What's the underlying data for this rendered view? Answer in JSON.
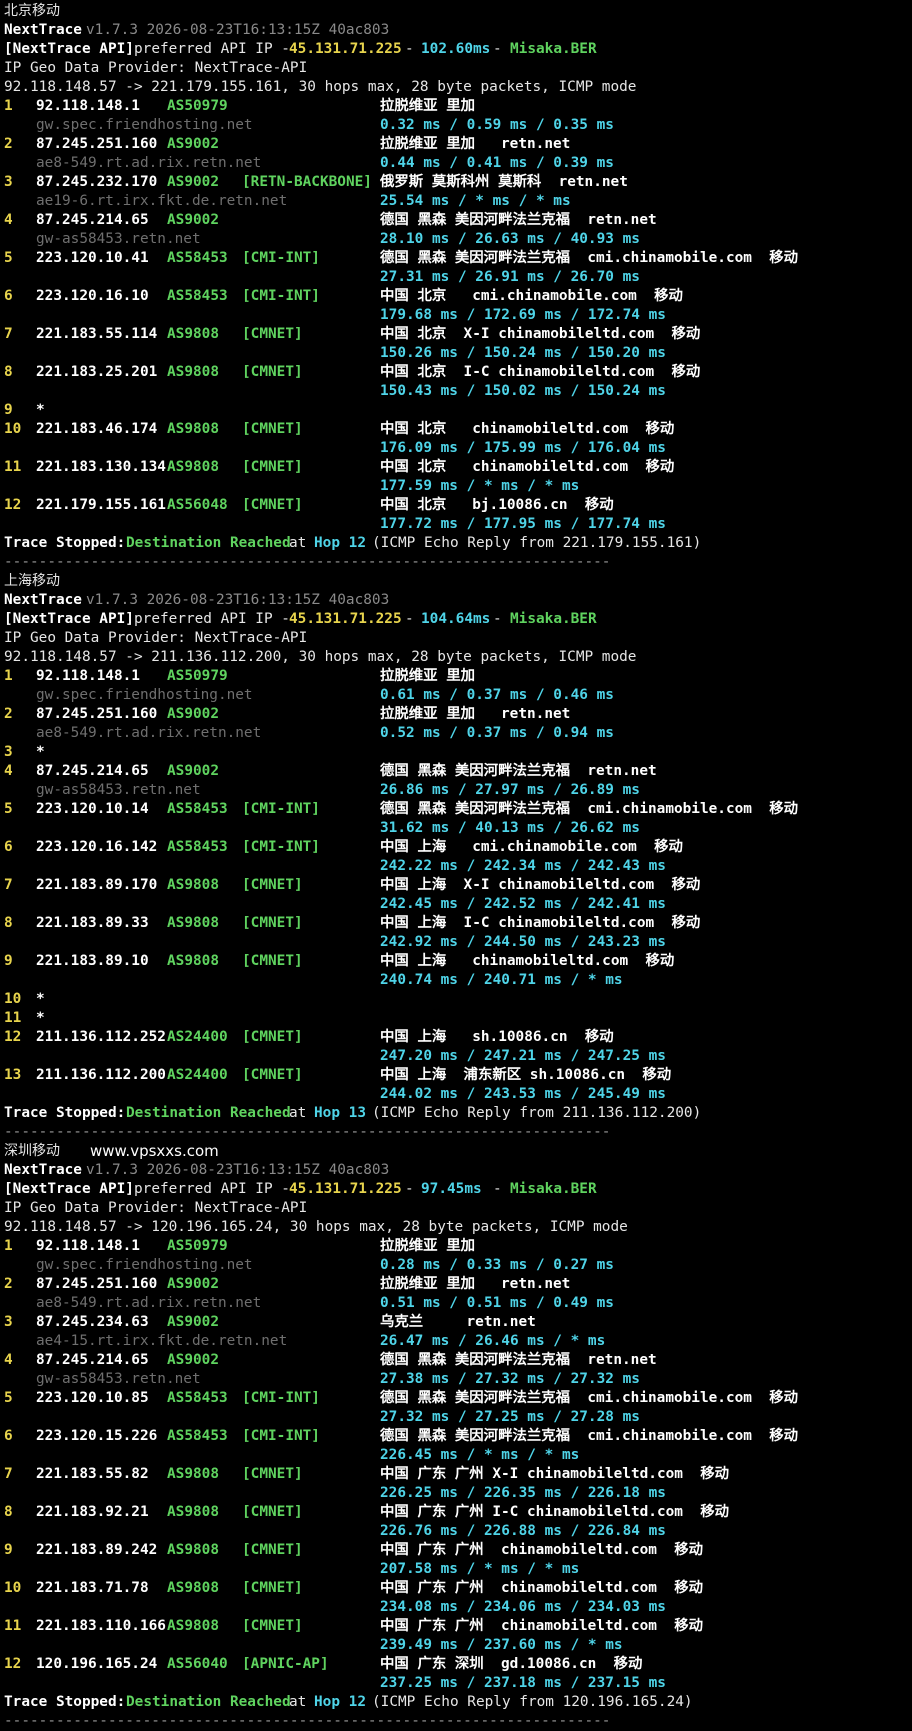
{
  "sections": [
    {
      "title": "北京移动",
      "watermark": "",
      "header": {
        "tool": "NextTrace",
        "version": "v1.7.3 2026-08-23T16:13:15Z 40ac803",
        "api_label": "[NextTrace API]",
        "api_text": "preferred API IP -",
        "api_ip": "45.131.71.225",
        "dash1": "-",
        "api_latency": "102.60ms",
        "dash2": "-",
        "api_node": "Misaka.BER",
        "geo_provider": "IP Geo Data Provider: NextTrace-API",
        "route": "92.118.148.57 -> 221.179.155.161, 30 hops max, 28 byte packets, ICMP mode"
      },
      "hops": [
        {
          "hop": "1",
          "ip": "92.118.148.1",
          "asn": "AS50979",
          "tag": "",
          "geo": "拉脱维亚 里加",
          "host": "gw.spec.friendhosting.net",
          "latency": "0.32 ms / 0.59 ms / 0.35 ms"
        },
        {
          "hop": "2",
          "ip": "87.245.251.160",
          "asn": "AS9002",
          "tag": "",
          "geo": "拉脱维亚 里加   retn.net",
          "host": "ae8-549.rt.ad.rix.retn.net",
          "latency": "0.44 ms / 0.41 ms / 0.39 ms"
        },
        {
          "hop": "3",
          "ip": "87.245.232.170",
          "asn": "AS9002",
          "tag": "[RETN-BACKBONE]",
          "geo": "俄罗斯 莫斯科州 莫斯科  retn.net",
          "host": "ae19-6.rt.irx.fkt.de.retn.net",
          "latency": "25.54 ms / * ms / * ms"
        },
        {
          "hop": "4",
          "ip": "87.245.214.65",
          "asn": "AS9002",
          "tag": "",
          "geo": "德国 黑森 美因河畔法兰克福  retn.net",
          "host": "gw-as58453.retn.net",
          "latency": "28.10 ms / 26.63 ms / 40.93 ms"
        },
        {
          "hop": "5",
          "ip": "223.120.10.41",
          "asn": "AS58453",
          "tag": "[CMI-INT]",
          "geo": "德国 黑森 美因河畔法兰克福  cmi.chinamobile.com  移动",
          "host": "",
          "latency": "27.31 ms / 26.91 ms / 26.70 ms"
        },
        {
          "hop": "6",
          "ip": "223.120.16.10",
          "asn": "AS58453",
          "tag": "[CMI-INT]",
          "geo": "中国 北京   cmi.chinamobile.com  移动",
          "host": "",
          "latency": "179.68 ms / 172.69 ms / 172.74 ms"
        },
        {
          "hop": "7",
          "ip": "221.183.55.114",
          "asn": "AS9808",
          "tag": "[CMNET]",
          "geo": "中国 北京  X-I chinamobileltd.com  移动",
          "host": "",
          "latency": "150.26 ms / 150.24 ms / 150.20 ms"
        },
        {
          "hop": "8",
          "ip": "221.183.25.201",
          "asn": "AS9808",
          "tag": "[CMNET]",
          "geo": "中国 北京  I-C chinamobileltd.com  移动",
          "host": "",
          "latency": "150.43 ms / 150.02 ms / 150.24 ms"
        },
        {
          "hop": "9",
          "ip": "*",
          "asn": "",
          "tag": "",
          "geo": "",
          "host": "",
          "latency": ""
        },
        {
          "hop": "10",
          "ip": "221.183.46.174",
          "asn": "AS9808",
          "tag": "[CMNET]",
          "geo": "中国 北京   chinamobileltd.com  移动",
          "host": "",
          "latency": "176.09 ms / 175.99 ms / 176.04 ms"
        },
        {
          "hop": "11",
          "ip": "221.183.130.134",
          "asn": "AS9808",
          "tag": "[CMNET]",
          "geo": "中国 北京   chinamobileltd.com  移动",
          "host": "",
          "latency": "177.59 ms / * ms / * ms"
        },
        {
          "hop": "12",
          "ip": "221.179.155.161",
          "asn": "AS56048",
          "tag": "[CMNET]",
          "geo": "中国 北京   bj.10086.cn  移动",
          "host": "",
          "latency": "177.72 ms / 177.95 ms / 177.74 ms"
        }
      ],
      "footer": {
        "stopped": "Trace Stopped:",
        "reached": "Destination Reached",
        "at": "at",
        "hop": "Hop 12",
        "rest": "(ICMP Echo Reply from 221.179.155.161)"
      }
    },
    {
      "title": "上海移动",
      "watermark": "",
      "header": {
        "tool": "NextTrace",
        "version": "v1.7.3 2026-08-23T16:13:15Z 40ac803",
        "api_label": "[NextTrace API]",
        "api_text": "preferred API IP -",
        "api_ip": "45.131.71.225",
        "dash1": "-",
        "api_latency": "104.64ms",
        "dash2": "-",
        "api_node": "Misaka.BER",
        "geo_provider": "IP Geo Data Provider: NextTrace-API",
        "route": "92.118.148.57 -> 211.136.112.200, 30 hops max, 28 byte packets, ICMP mode"
      },
      "hops": [
        {
          "hop": "1",
          "ip": "92.118.148.1",
          "asn": "AS50979",
          "tag": "",
          "geo": "拉脱维亚 里加",
          "host": "gw.spec.friendhosting.net",
          "latency": "0.61 ms / 0.37 ms / 0.46 ms"
        },
        {
          "hop": "2",
          "ip": "87.245.251.160",
          "asn": "AS9002",
          "tag": "",
          "geo": "拉脱维亚 里加   retn.net",
          "host": "ae8-549.rt.ad.rix.retn.net",
          "latency": "0.52 ms / 0.37 ms / 0.94 ms"
        },
        {
          "hop": "3",
          "ip": "*",
          "asn": "",
          "tag": "",
          "geo": "",
          "host": "",
          "latency": ""
        },
        {
          "hop": "4",
          "ip": "87.245.214.65",
          "asn": "AS9002",
          "tag": "",
          "geo": "德国 黑森 美因河畔法兰克福  retn.net",
          "host": "gw-as58453.retn.net",
          "latency": "26.86 ms / 27.97 ms / 26.89 ms"
        },
        {
          "hop": "5",
          "ip": "223.120.10.14",
          "asn": "AS58453",
          "tag": "[CMI-INT]",
          "geo": "德国 黑森 美因河畔法兰克福  cmi.chinamobile.com  移动",
          "host": "",
          "latency": "31.62 ms / 40.13 ms / 26.62 ms"
        },
        {
          "hop": "6",
          "ip": "223.120.16.142",
          "asn": "AS58453",
          "tag": "[CMI-INT]",
          "geo": "中国 上海   cmi.chinamobile.com  移动",
          "host": "",
          "latency": "242.22 ms / 242.34 ms / 242.43 ms"
        },
        {
          "hop": "7",
          "ip": "221.183.89.170",
          "asn": "AS9808",
          "tag": "[CMNET]",
          "geo": "中国 上海  X-I chinamobileltd.com  移动",
          "host": "",
          "latency": "242.45 ms / 242.52 ms / 242.41 ms"
        },
        {
          "hop": "8",
          "ip": "221.183.89.33",
          "asn": "AS9808",
          "tag": "[CMNET]",
          "geo": "中国 上海  I-C chinamobileltd.com  移动",
          "host": "",
          "latency": "242.92 ms / 244.50 ms / 243.23 ms"
        },
        {
          "hop": "9",
          "ip": "221.183.89.10",
          "asn": "AS9808",
          "tag": "[CMNET]",
          "geo": "中国 上海   chinamobileltd.com  移动",
          "host": "",
          "latency": "240.74 ms / 240.71 ms / * ms"
        },
        {
          "hop": "10",
          "ip": "*",
          "asn": "",
          "tag": "",
          "geo": "",
          "host": "",
          "latency": ""
        },
        {
          "hop": "11",
          "ip": "*",
          "asn": "",
          "tag": "",
          "geo": "",
          "host": "",
          "latency": ""
        },
        {
          "hop": "12",
          "ip": "211.136.112.252",
          "asn": "AS24400",
          "tag": "[CMNET]",
          "geo": "中国 上海   sh.10086.cn  移动",
          "host": "",
          "latency": "247.20 ms / 247.21 ms / 247.25 ms"
        },
        {
          "hop": "13",
          "ip": "211.136.112.200",
          "asn": "AS24400",
          "tag": "[CMNET]",
          "geo": "中国 上海  浦东新区 sh.10086.cn  移动",
          "host": "",
          "latency": "244.02 ms / 243.53 ms / 245.49 ms"
        }
      ],
      "footer": {
        "stopped": "Trace Stopped:",
        "reached": "Destination Reached",
        "at": "at",
        "hop": "Hop 13",
        "rest": "(ICMP Echo Reply from 211.136.112.200)"
      }
    },
    {
      "title": "深圳移动",
      "watermark": "www.vpsxxs.com",
      "header": {
        "tool": "NextTrace",
        "version": "v1.7.3 2026-08-23T16:13:15Z 40ac803",
        "api_label": "[NextTrace API]",
        "api_text": "preferred API IP -",
        "api_ip": "45.131.71.225",
        "dash1": "-",
        "api_latency": "97.45ms",
        "dash2": "-",
        "api_node": "Misaka.BER",
        "geo_provider": "IP Geo Data Provider: NextTrace-API",
        "route": "92.118.148.57 -> 120.196.165.24, 30 hops max, 28 byte packets, ICMP mode"
      },
      "hops": [
        {
          "hop": "1",
          "ip": "92.118.148.1",
          "asn": "AS50979",
          "tag": "",
          "geo": "拉脱维亚 里加",
          "host": "gw.spec.friendhosting.net",
          "latency": "0.28 ms / 0.33 ms / 0.27 ms"
        },
        {
          "hop": "2",
          "ip": "87.245.251.160",
          "asn": "AS9002",
          "tag": "",
          "geo": "拉脱维亚 里加   retn.net",
          "host": "ae8-549.rt.ad.rix.retn.net",
          "latency": "0.51 ms / 0.51 ms / 0.49 ms"
        },
        {
          "hop": "3",
          "ip": "87.245.234.63",
          "asn": "AS9002",
          "tag": "",
          "geo": "乌克兰     retn.net",
          "host": "ae4-15.rt.irx.fkt.de.retn.net",
          "latency": "26.47 ms / 26.46 ms / * ms"
        },
        {
          "hop": "4",
          "ip": "87.245.214.65",
          "asn": "AS9002",
          "tag": "",
          "geo": "德国 黑森 美因河畔法兰克福  retn.net",
          "host": "gw-as58453.retn.net",
          "latency": "27.38 ms / 27.32 ms / 27.32 ms"
        },
        {
          "hop": "5",
          "ip": "223.120.10.85",
          "asn": "AS58453",
          "tag": "[CMI-INT]",
          "geo": "德国 黑森 美因河畔法兰克福  cmi.chinamobile.com  移动",
          "host": "",
          "latency": "27.32 ms / 27.25 ms / 27.28 ms"
        },
        {
          "hop": "6",
          "ip": "223.120.15.226",
          "asn": "AS58453",
          "tag": "[CMI-INT]",
          "geo": "德国 黑森 美因河畔法兰克福  cmi.chinamobile.com  移动",
          "host": "",
          "latency": "226.45 ms / * ms / * ms"
        },
        {
          "hop": "7",
          "ip": "221.183.55.82",
          "asn": "AS9808",
          "tag": "[CMNET]",
          "geo": "中国 广东 广州 X-I chinamobileltd.com  移动",
          "host": "",
          "latency": "226.25 ms / 226.35 ms / 226.18 ms"
        },
        {
          "hop": "8",
          "ip": "221.183.92.21",
          "asn": "AS9808",
          "tag": "[CMNET]",
          "geo": "中国 广东 广州 I-C chinamobileltd.com  移动",
          "host": "",
          "latency": "226.76 ms / 226.88 ms / 226.84 ms"
        },
        {
          "hop": "9",
          "ip": "221.183.89.242",
          "asn": "AS9808",
          "tag": "[CMNET]",
          "geo": "中国 广东 广州  chinamobileltd.com  移动",
          "host": "",
          "latency": "207.58 ms / * ms / * ms"
        },
        {
          "hop": "10",
          "ip": "221.183.71.78",
          "asn": "AS9808",
          "tag": "[CMNET]",
          "geo": "中国 广东 广州  chinamobileltd.com  移动",
          "host": "",
          "latency": "234.08 ms / 234.06 ms / 234.03 ms"
        },
        {
          "hop": "11",
          "ip": "221.183.110.166",
          "asn": "AS9808",
          "tag": "[CMNET]",
          "geo": "中国 广东 广州  chinamobileltd.com  移动",
          "host": "",
          "latency": "239.49 ms / 237.60 ms / * ms"
        },
        {
          "hop": "12",
          "ip": "120.196.165.24",
          "asn": "AS56040",
          "tag": "[APNIC-AP]",
          "geo": "中国 广东 深圳  gd.10086.cn  移动",
          "host": "",
          "latency": "237.25 ms / 237.18 ms / 237.15 ms"
        }
      ],
      "footer": {
        "stopped": "Trace Stopped:",
        "reached": "Destination Reached",
        "at": "at",
        "hop": "Hop 12",
        "rest": "(ICMP Echo Reply from 120.196.165.24)"
      }
    }
  ],
  "separator": "----------------------------------------------------------------------"
}
